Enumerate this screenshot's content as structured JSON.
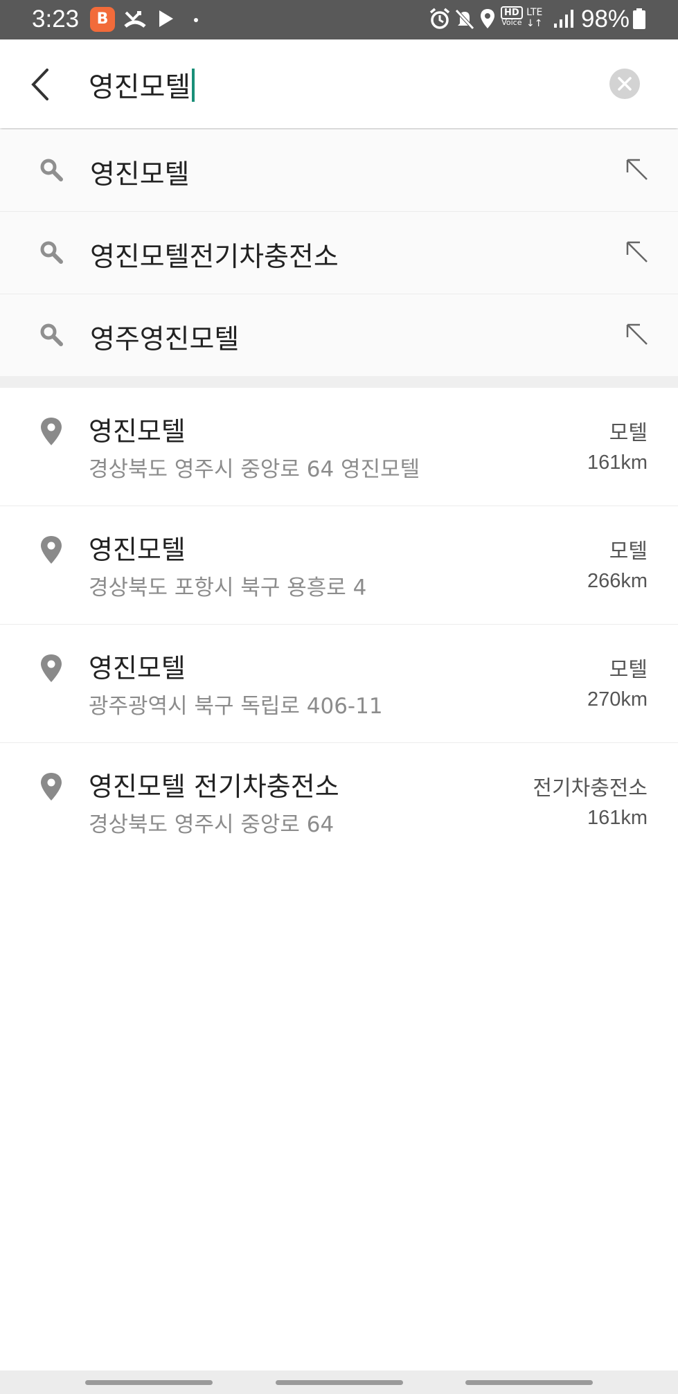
{
  "status_bar": {
    "time": "3:23",
    "battery": "98%",
    "hd_label": "HD",
    "voice_label": "Voice",
    "lte_label": "LTE",
    "icons": [
      "app-badge-icon",
      "missed-call-icon",
      "play-icon",
      "dot-icon",
      "alarm-icon",
      "mute-icon",
      "location-icon",
      "hd-voice-icon",
      "lte-icon",
      "signal-icon",
      "battery-icon"
    ]
  },
  "search": {
    "query": "영진모텔",
    "accent_color": "#1a8f78"
  },
  "suggestions": [
    {
      "label": "영진모텔"
    },
    {
      "label": "영진모텔전기차충전소"
    },
    {
      "label": "영주영진모텔"
    }
  ],
  "results": [
    {
      "title": "영진모텔",
      "address": "경상북도 영주시 중앙로 64 영진모텔",
      "category": "모텔",
      "distance": "161km"
    },
    {
      "title": "영진모텔",
      "address": "경상북도 포항시 북구 용흥로 4",
      "category": "모텔",
      "distance": "266km"
    },
    {
      "title": "영진모텔",
      "address": "광주광역시 북구 독립로 406-11",
      "category": "모텔",
      "distance": "270km"
    },
    {
      "title": "영진모텔 전기차충전소",
      "address": "경상북도 영주시 중앙로 64",
      "category": "전기차충전소",
      "distance": "161km"
    }
  ]
}
